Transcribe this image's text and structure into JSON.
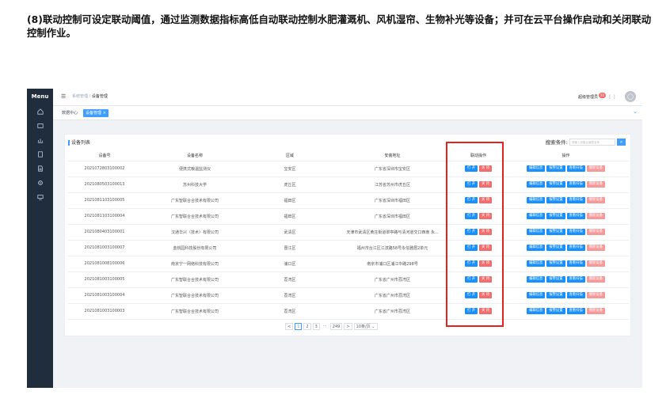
{
  "caption": "(8)联动控制可设定联动阈值，通过监测数据指标高低自动联动控制水肥灌溉机、风机湿帘、生物补光等设备；并可在云平台操作启动和关闭联动控制作业。",
  "sidebar": {
    "title": "Menu",
    "icons": [
      "home-icon",
      "cloud-icon",
      "chart-icon",
      "device-icon",
      "document-icon",
      "gear-icon",
      "monitor-icon"
    ]
  },
  "header": {
    "breadcrumb": [
      "系统管理",
      "设备管理"
    ],
    "user_label": "超级管理员",
    "badge": "20",
    "dots": "⋮⋮"
  },
  "tags": {
    "home": "数据中心",
    "active": "设备管理 ×"
  },
  "card": {
    "title": "设备列表",
    "search_label": "搜索条件:",
    "search_placeholder": "请输入设备比编表名称"
  },
  "table": {
    "columns": [
      "设备号",
      "设备名称",
      "区域",
      "安装地址",
      "联动操作",
      "操作"
    ],
    "rows": [
      {
        "id": "2021072803100002",
        "name": "便携式粮温监测仪",
        "area": "宝安区",
        "addr": "广东省深圳市宝安区"
      },
      {
        "id": "2021080503100013",
        "name": "苏州科技大学",
        "area": "虎丘区",
        "addr": "江苏省苏州市虎丘区"
      },
      {
        "id": "2021081103100005",
        "name": "广东智联合合技术有限公司",
        "area": "福田区",
        "addr": "广东省深圳市福田区"
      },
      {
        "id": "2021081103100004",
        "name": "广东智联合合技术有限公司",
        "area": "福田区",
        "addr": "广东省深圳市福田区"
      },
      {
        "id": "2021080403100001",
        "name": "汉通华兴（技术）有限公司",
        "area": "武清区",
        "addr": "天津市武清区黄庄街道翠亭路与清河道交口西南 永..."
      },
      {
        "id": "2021081003100007",
        "name": "金桃园科技股份有限公司",
        "area": "晋江区",
        "addr": "福州市台江区江滨路58号永信雅居2单元"
      },
      {
        "id": "2021081008100006",
        "name": "南京宁一网络科技有限公司",
        "area": "浦口区",
        "addr": "南京市浦口区浦江中路298号"
      },
      {
        "id": "2021081003100005",
        "name": "广东智联合合技术有限公司",
        "area": "荔湾区",
        "addr": "广东省广州市荔湾区"
      },
      {
        "id": "2021081003100004",
        "name": "广东智联合合技术有限公司",
        "area": "荔湾区",
        "addr": "广东省广州市荔湾区"
      },
      {
        "id": "2021081003100003",
        "name": "广东智联合合技术有限公司",
        "area": "荔湾区",
        "addr": "广东省广州市荔湾区"
      }
    ],
    "btn_open": "打 开",
    "btn_close": "关 闭",
    "btn_edit": "编辑信息",
    "btn_alarm": "报警设置",
    "btn_scan": "查看扫描",
    "btn_delete": "删除设备"
  },
  "pager": {
    "prev": "<",
    "pages": [
      "1",
      "2",
      "3"
    ],
    "ellipsis": "···",
    "last": "249",
    "next": ">",
    "size": "10条/页 ⌄"
  },
  "colors": {
    "accent": "#409eff",
    "sidebar": "#1f2d3d",
    "danger": "#f56c6c",
    "highlight": "#e0231c"
  }
}
